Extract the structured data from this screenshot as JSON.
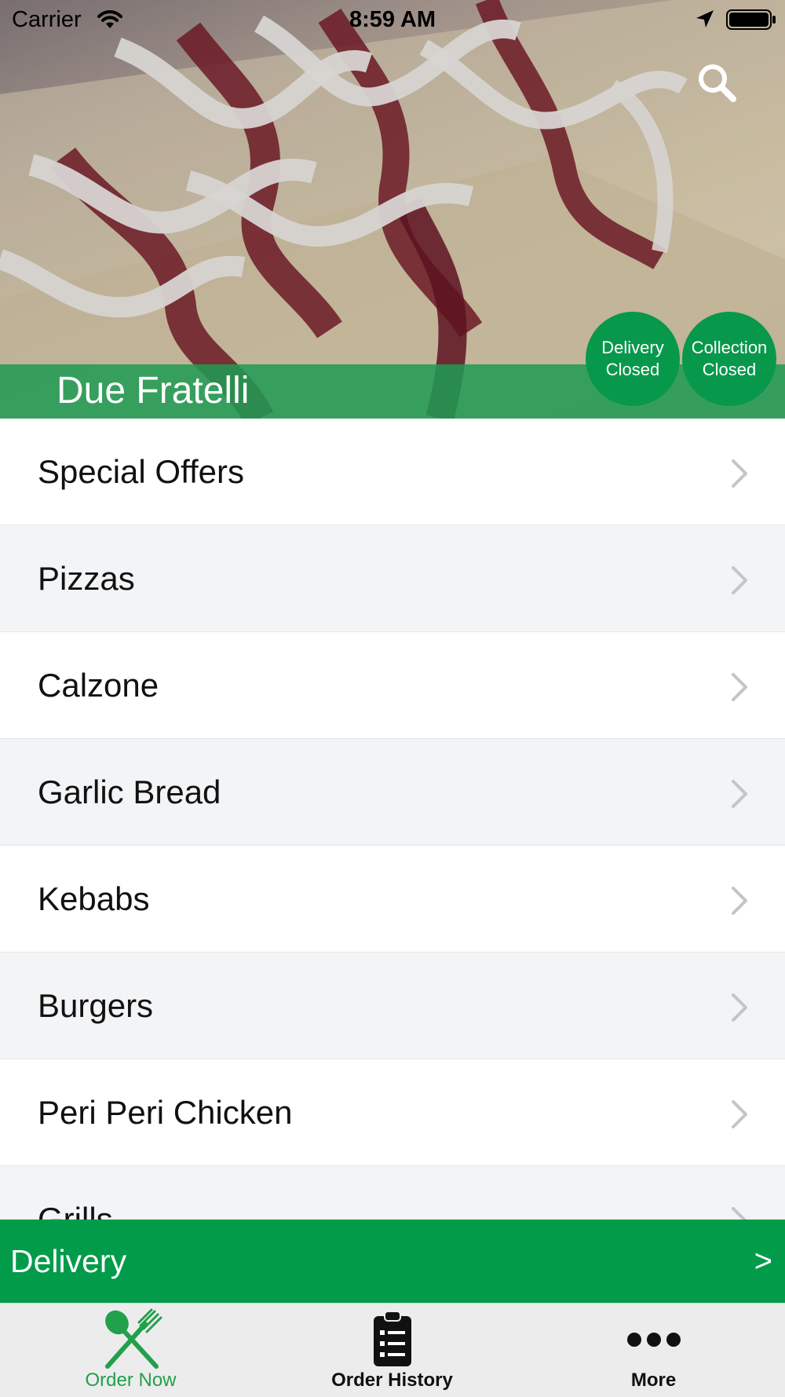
{
  "status_bar": {
    "carrier": "Carrier",
    "time": "8:59 AM"
  },
  "hero": {
    "restaurant_name": "Due Fratelli",
    "search_icon": "search-icon",
    "badges": [
      {
        "line1": "Delivery",
        "line2": "Closed"
      },
      {
        "line1": "Collection",
        "line2": "Closed"
      }
    ]
  },
  "menu": {
    "items": [
      {
        "label": "Special Offers"
      },
      {
        "label": "Pizzas"
      },
      {
        "label": "Calzone"
      },
      {
        "label": "Garlic Bread"
      },
      {
        "label": "Kebabs"
      },
      {
        "label": "Burgers"
      },
      {
        "label": "Peri Peri Chicken"
      },
      {
        "label": "Grills"
      }
    ]
  },
  "delivery_bar": {
    "label": "Delivery",
    "arrow": ">"
  },
  "tab_bar": {
    "tabs": [
      {
        "label": "Order Now",
        "icon": "fork-knife-icon",
        "active": true
      },
      {
        "label": "Order History",
        "icon": "clipboard-list-icon",
        "active": false
      },
      {
        "label": "More",
        "icon": "more-dots-icon",
        "active": false
      }
    ]
  },
  "colors": {
    "brand_green": "#019b4a",
    "active_tab": "#22a04b",
    "list_alt_row": "#f3f4f6"
  }
}
